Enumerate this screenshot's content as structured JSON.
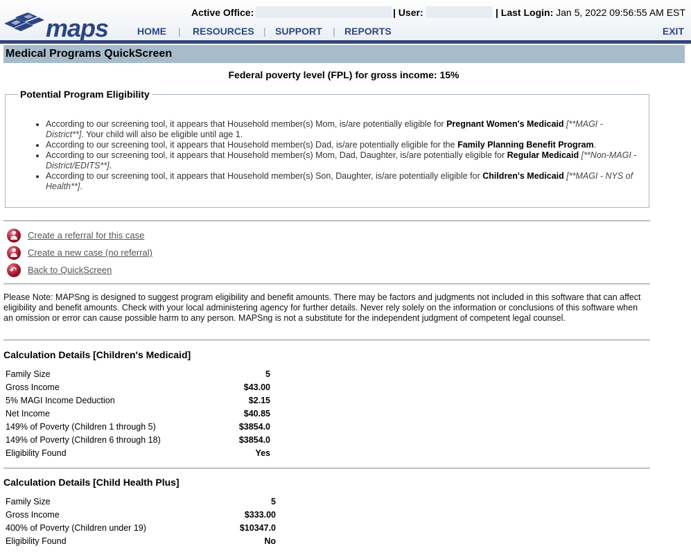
{
  "header": {
    "logo_text": "maps",
    "active_office_label": "Active Office:",
    "user_label": "| User:",
    "last_login_label": "| Last Login:",
    "last_login_value": "Jan 5, 2022 09:56:55 AM EST",
    "nav": [
      "HOME",
      "RESOURCES",
      "SUPPORT",
      "REPORTS"
    ],
    "exit_label": "EXIT",
    "brand_color": "#2b4584",
    "bar_color": "#33477a"
  },
  "page_title": "Medical Programs QuickScreen",
  "fpl_text": "Federal poverty level (FPL) for gross income: 15%",
  "eligibility": {
    "legend": "Potential Program Eligibility",
    "items": [
      {
        "pre": "According to our screening tool, it appears that Household member(s) Mom, is/are potentially eligible for ",
        "program": "Pregnant Women's Medicaid",
        "tag": " [**MAGI - District**]",
        "post": ". Your child will also be eligible until age 1."
      },
      {
        "pre": "According to our screening tool, it appears that Household member(s) Dad, is/are potentially eligible for the ",
        "program": "Family Planning Benefit Program",
        "tag": "",
        "post": "."
      },
      {
        "pre": "According to our screening tool, it appears that Household member(s) Mom, Dad, Daughter, is/are potentially eligible for ",
        "program": "Regular Medicaid",
        "tag": " [**Non-MAGI - District/EDITS**]",
        "post": "."
      },
      {
        "pre": "According to our screening tool, it appears that Household member(s) Son, Daughter, is/are potentially eligible for ",
        "program": "Children's Medicaid",
        "tag": " [**MAGI - NYS of Health**]",
        "post": "."
      }
    ]
  },
  "actions": {
    "create_referral": "Create a referral for this case",
    "create_case": "Create a new case (no referral)",
    "back": "Back to QuickScreen"
  },
  "note": "Please Note: MAPSng is designed to suggest program eligibility and benefit amounts. There may be factors and judgments not included in this software that can affect eligibility and benefit amounts. Check with your local administering agency for further details. Never rely solely on the information or conclusions of this software when an omission or error can cause possible harm to any person. MAPSng is not a substitute for the independent judgment of competent legal counsel.",
  "calc1": {
    "title": "Calculation Details [Children's Medicaid]",
    "rows": [
      {
        "label": "Family Size",
        "value": "5"
      },
      {
        "label": "Gross Income",
        "value": "$43.00"
      },
      {
        "label": "5% MAGI Income Deduction",
        "value": "$2.15"
      },
      {
        "label": "Net Income",
        "value": "$40.85"
      },
      {
        "label": "149% of Poverty (Children 1 through 5)",
        "value": "$3854.0"
      },
      {
        "label": "149% of Poverty (Children 6 through 18)",
        "value": "$3854.0"
      },
      {
        "label": "Eligibility Found",
        "value": "Yes"
      }
    ]
  },
  "calc2": {
    "title": "Calculation Details [Child Health Plus]",
    "rows": [
      {
        "label": "Family Size",
        "value": "5"
      },
      {
        "label": "Gross Income",
        "value": "$333.00"
      },
      {
        "label": "400% of Poverty (Children under 19)",
        "value": "$10347.0"
      },
      {
        "label": "Eligibility Found",
        "value": "No"
      }
    ]
  }
}
